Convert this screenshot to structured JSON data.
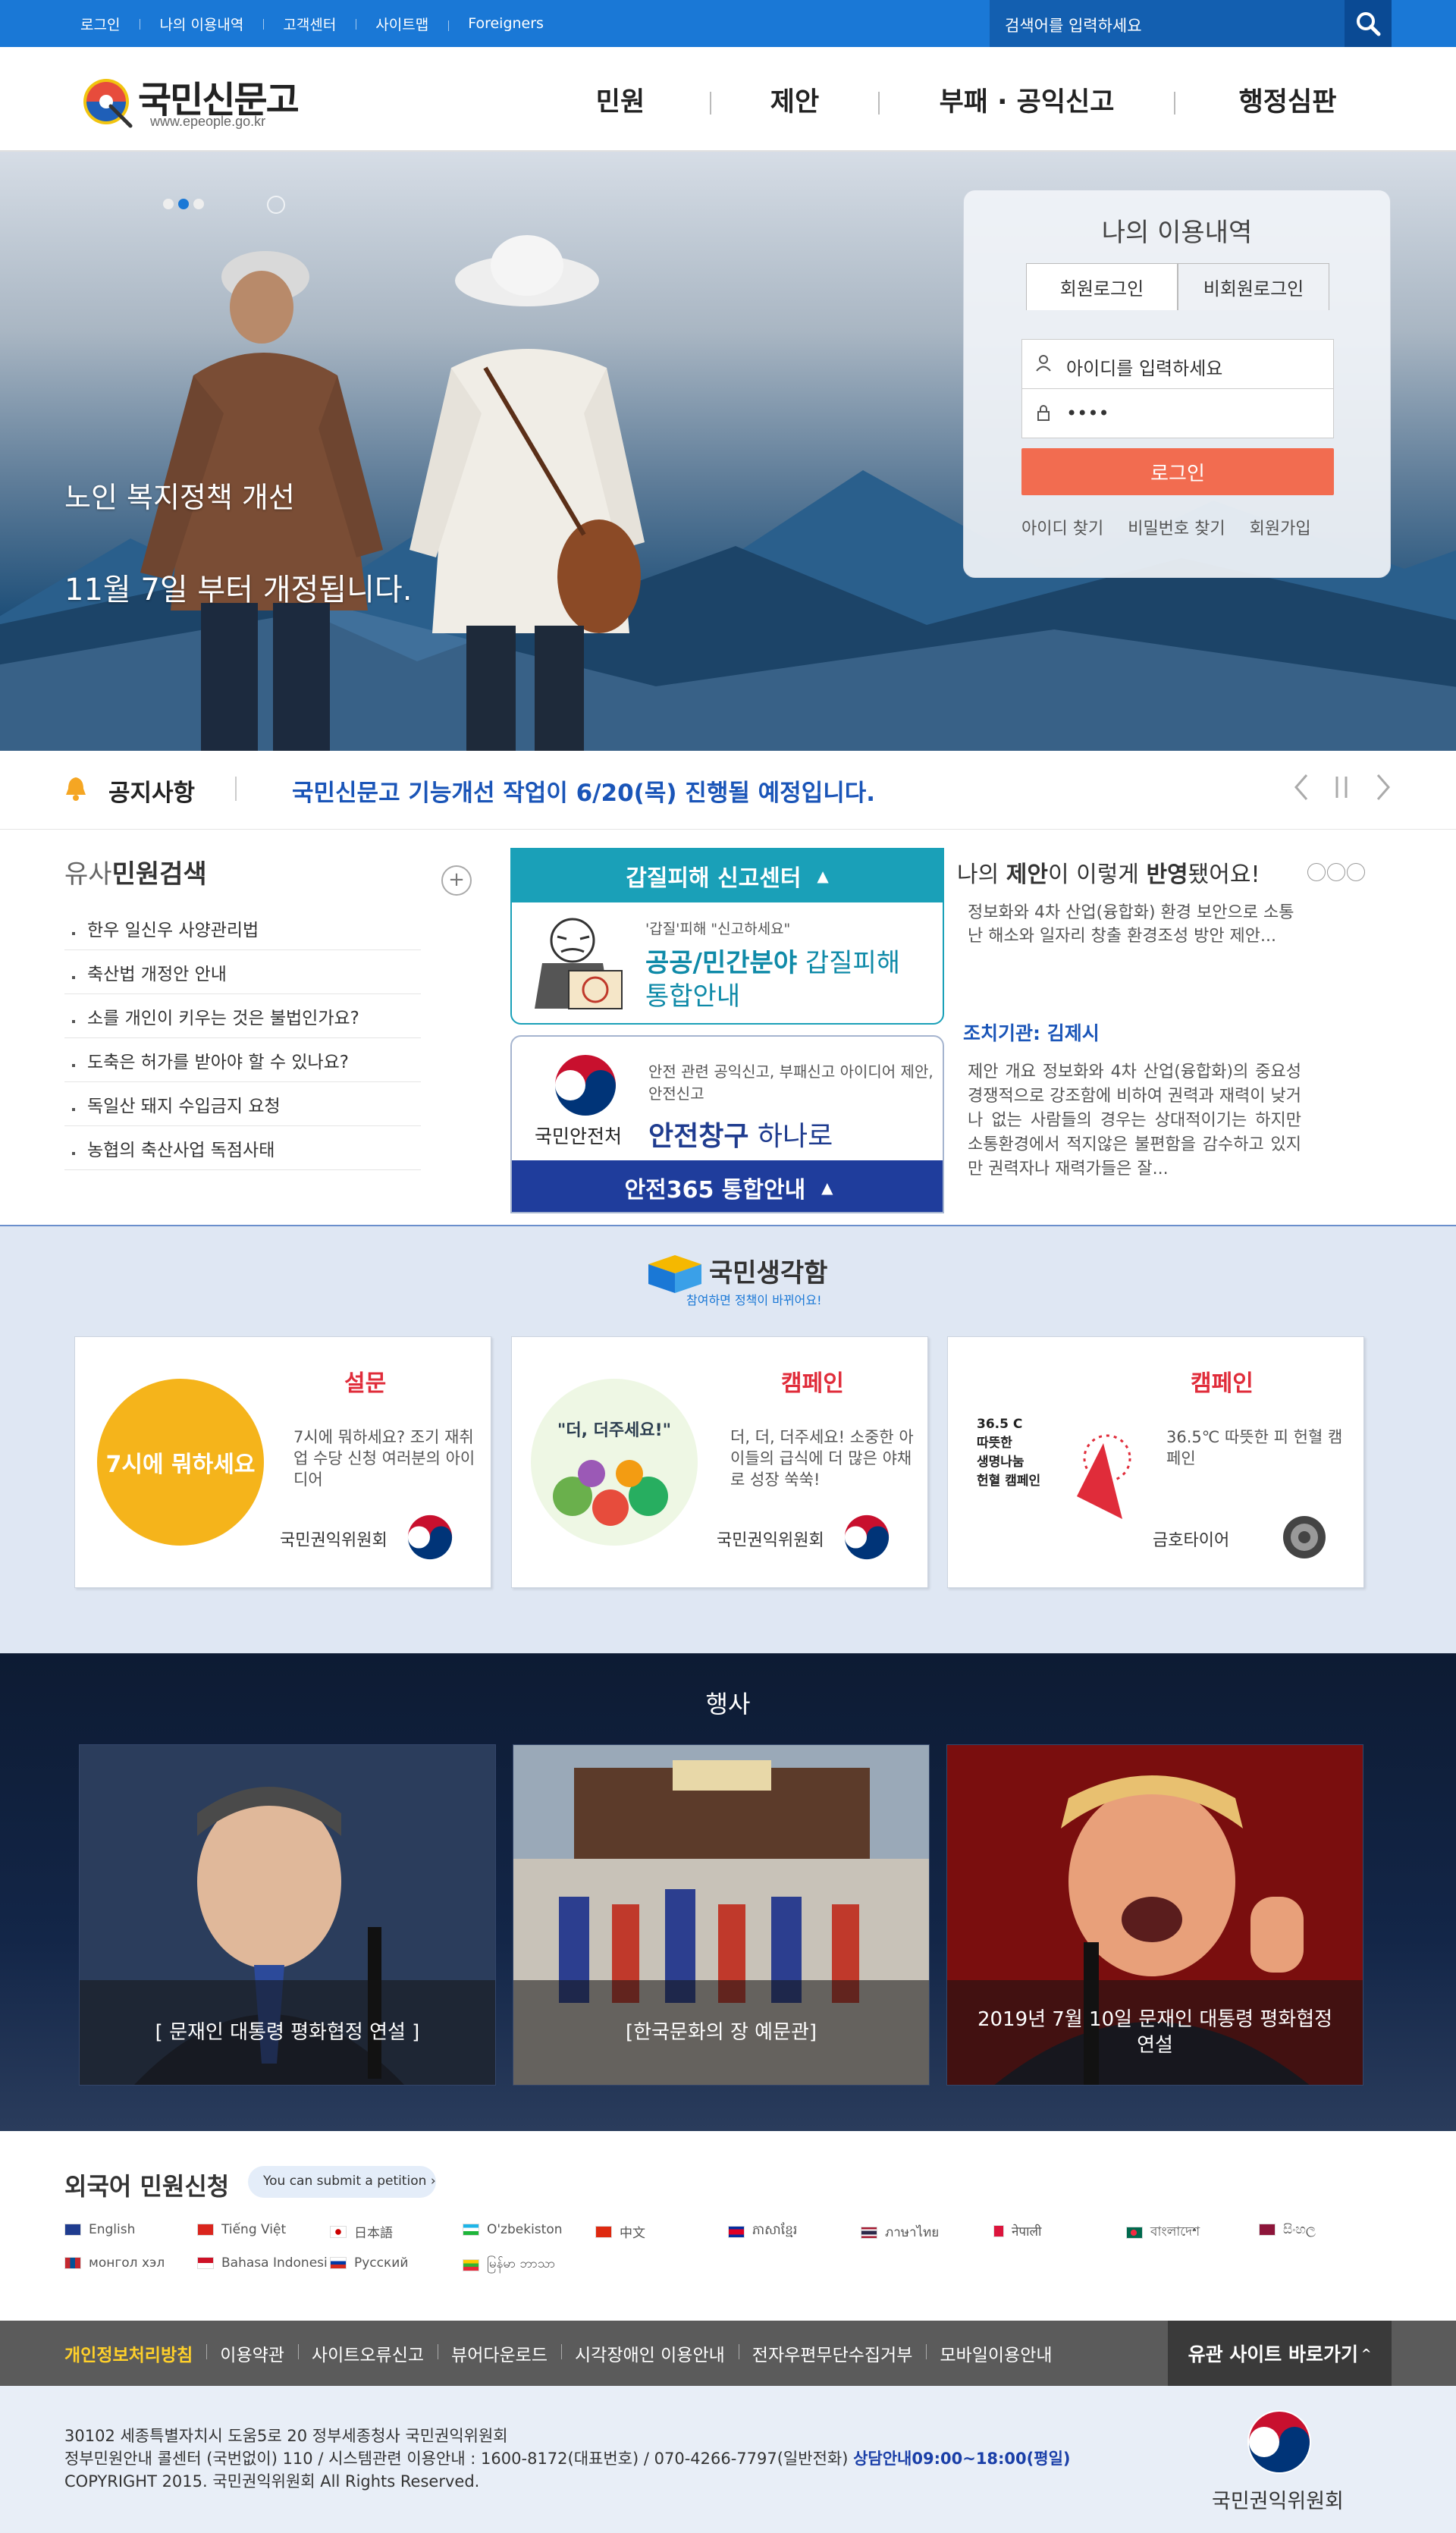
{
  "util": {
    "links": [
      "로그인",
      "나의 이용내역",
      "고객센터",
      "사이트맵",
      "Foreigners"
    ],
    "search_placeholder": "검색어를 입력하세요"
  },
  "header": {
    "logo_title": "국민신문고",
    "logo_url": "www.epeople.go.kr",
    "menu": [
      "민원",
      "제안",
      "부패 · 공익신고",
      "행정심판"
    ]
  },
  "hero": {
    "caption1": "노인 복지정책 개선",
    "caption2": "11월 7일 부터 개정됩니다."
  },
  "login": {
    "title": "나의 이용내역",
    "tab_member": "회원로그인",
    "tab_guest": "비회원로그인",
    "id_placeholder": "아이디를 입력하세요",
    "pw_value": "••••",
    "button": "로그인",
    "find_id": "아이디 찾기",
    "find_pw": "비밀번호 찾기",
    "join": "회원가입"
  },
  "notice": {
    "label": "공지사항",
    "text": "국민신문고 기능개선 작업이 6/20(목) 진행될 예정입니다."
  },
  "similar": {
    "title_pre": "유사",
    "title_bold": "민원검색",
    "items": [
      "한우 일신우 사양관리법",
      "축산법 개정안 안내",
      "소를 개인이 키우는 것은 불법인가요?",
      "도축은 허가를 받아야 할 수 있나요?",
      "독일산 돼지 수입금지 요청",
      "농협의 축산사업 독점사태"
    ]
  },
  "gabjil": {
    "header": "갑질피해 신고센터",
    "small": "'갑질'피해 \"신고하세요\"",
    "big_bold": "공공/민간분야",
    "big_rest": " 갑질피해",
    "big2": "통합안내"
  },
  "safety": {
    "org": "국민안전처",
    "desc": "안전 관련 공익신고, 부패신고 아이디어 제안, 안전신고",
    "big_bold": "안전창구",
    "big_rest": " 하나로",
    "footer": "안전365 통합안내"
  },
  "myprop": {
    "title_pre": "나의 ",
    "title_bold1": "제안",
    "title_mid": "이 이렇게 ",
    "title_bold2": "반영",
    "title_post": "됐어요!",
    "p1": "정보화와 4차 산업(융합화) 환경 보안으로 소통난 해소와 일자리 창출 환경조성 방안 제안...",
    "org": "조치기관: 김제시",
    "p2": "제안 개요 정보화와 4차 산업(융합화)의 중요성 경쟁적으로 강조함에 비하여 권력과 재력이 낮거나 없는 사람들의 경우는 상대적이기는 하지만 소통환경에서 적지않은 불편함을 감수하고 있지만 권력자나 재력가들은 잘..."
  },
  "share": {
    "logo_title": "국민생각함",
    "logo_sub": "참여하면 정책이 바뀌어요!",
    "cards": [
      {
        "tag": "설문",
        "desc": "7시에 뭐하세요? 조기 재취업 수당 신청 여러분의 아이디어",
        "org": "국민권익위원회"
      },
      {
        "tag": "캠페인",
        "desc": "더, 더, 더주세요! 소중한 아이들의 급식에 더 많은 야채로 성장 쑥쑥!",
        "org": "국민권익위원회"
      },
      {
        "tag": "캠페인",
        "desc": "36.5℃ 따뜻한 피 헌혈 캠페인",
        "org": "금호타이어"
      }
    ],
    "card1_art": "7시에 뭐하세요",
    "card2_art": "\"더, 더주세요!\"",
    "card3_art": "36.5 C\n따뜻한\n생명나눔\n헌혈 캠페인"
  },
  "events": {
    "title": "행사",
    "items": [
      "[ 문재인 대통령 평화협정 연설 ]",
      "[한국문화의 장 예문관]",
      "2019년 7월 10일 문재인 대통령 평화협정 연설"
    ]
  },
  "foreign": {
    "title": "외국어 민원신청",
    "pill": "You can submit a petition",
    "langs": [
      "English",
      "Tiếng Việt",
      "日本語",
      "O'zbekiston",
      "中文",
      "ភាសាខ្មែរ",
      "ภาษาไทย",
      "नेपाली",
      "বাংলাদেশ",
      "සිංහල",
      "монгол хэл",
      "Bahasa Indonesi",
      "Русский",
      "မြန်မာ ဘာသာ"
    ]
  },
  "footer": {
    "links": [
      "개인정보처리방침",
      "이용약관",
      "사이트오류신고",
      "뷰어다운로드",
      "시각장애인 이용안내",
      "전자우편무단수집거부",
      "모바일이용안내"
    ],
    "related": "유관 사이트 바로가기",
    "addr": "30102 세종특별자치시 도움5로 20 정부세종청사 국민권익위원회",
    "call": "정부민원안내 콜센터 (국번없이) 110 / 시스템관련 이용안내 : 1600-8172(대표번호) / 070-4266-7797(일반전화)",
    "hours": "상담안내09:00~18:00(평일)",
    "copyright": "COPYRIGHT 2015. 국민권익위원회 All Rights Reserved.",
    "org": "국민권익위원회"
  }
}
